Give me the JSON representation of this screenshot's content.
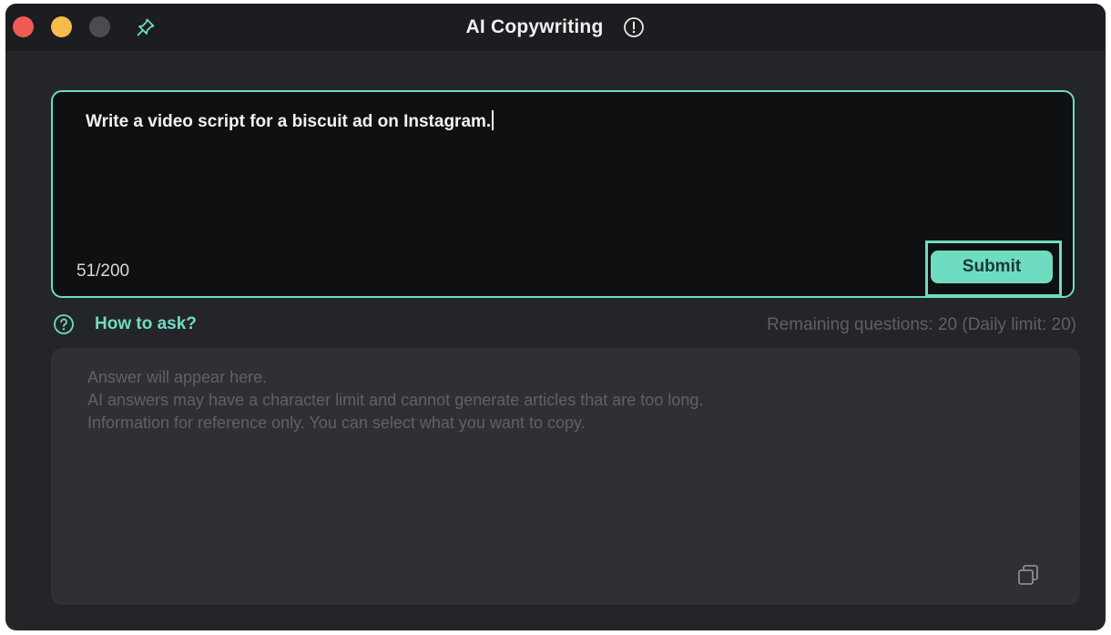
{
  "window": {
    "title": "AI Copywriting"
  },
  "titlebar": {
    "traffic_lights": [
      {
        "name": "close",
        "color": "#ee5b55"
      },
      {
        "name": "minimize",
        "color": "#f4bd4b"
      },
      {
        "name": "zoom",
        "color": "#4a4c50"
      }
    ],
    "pin_icon": "pin-icon",
    "info_icon": "info-circle-icon"
  },
  "prompt": {
    "value": "Write a video script for a biscuit ad on Instagram.",
    "char_count": "51/200",
    "submit_label": "Submit"
  },
  "help": {
    "icon": "question-circle-icon",
    "link_label": "How to ask?",
    "remaining_text": "Remaining questions: 20 (Daily limit:  20)"
  },
  "answer": {
    "placeholder_lines": [
      "Answer will appear here.",
      "AI answers may have a character limit and cannot generate articles that are too long.",
      "Information for reference only. You can select what you want to copy."
    ],
    "copy_icon": "copy-icon"
  },
  "colors": {
    "accent": "#6fdcc2",
    "window_bg": "#232528",
    "input_bg": "#0f1012",
    "answer_bg": "#2e3034",
    "muted_text": "#5f6165"
  }
}
